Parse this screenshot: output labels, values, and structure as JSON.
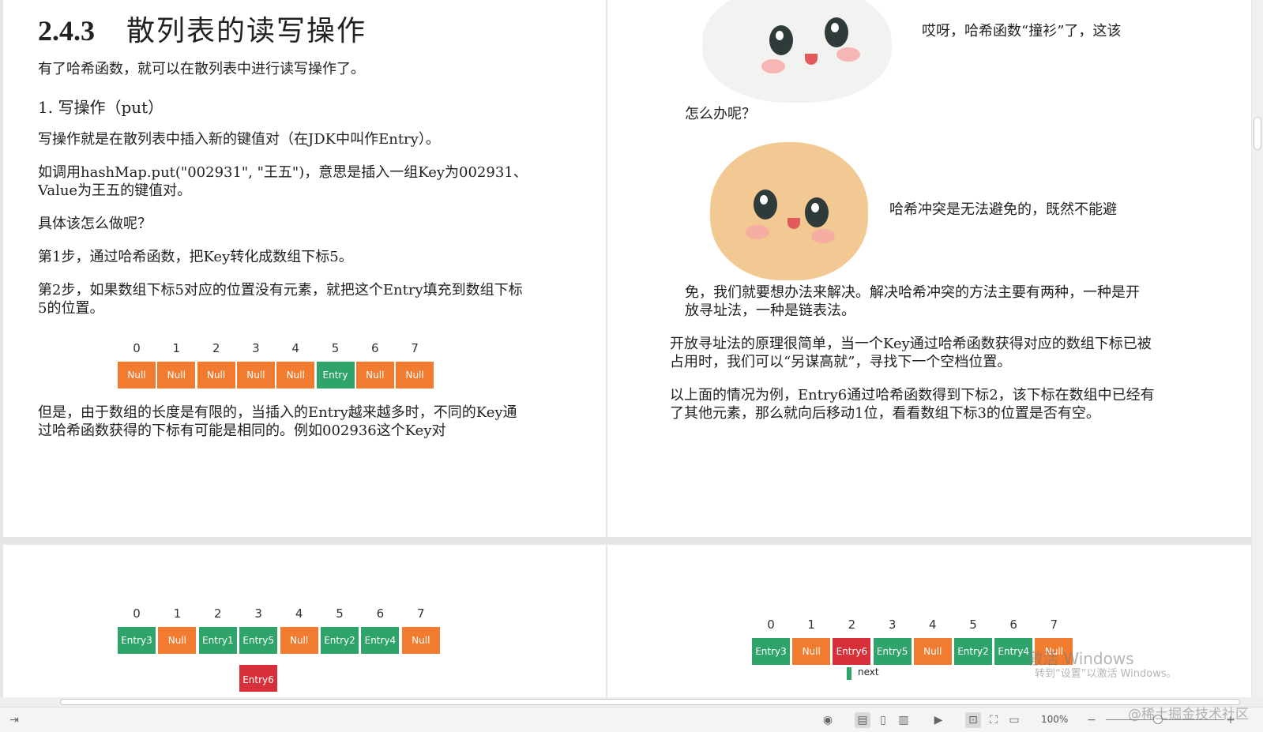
{
  "page1": {
    "section_num": "2.4.3",
    "section_title": "散列表的读写操作",
    "intro": "有了哈希函数，就可以在散列表中进行读写操作了。",
    "heading": "1. 写操作（put）",
    "p1": "写操作就是在散列表中插入新的键值对（在JDK中叫作Entry）。",
    "p2": "如调用hashMap.put(\"002931\", \"王五\")，意思是插入一组Key为002931、Value为王五的键值对。",
    "p3": "具体该怎么做呢？",
    "p4": "第1步，通过哈希函数，把Key转化成数组下标5。",
    "p5": "第2步，如果数组下标5对应的位置没有元素，就把这个Entry填充到数组下标5的位置。",
    "array": {
      "indices": [
        "0",
        "1",
        "2",
        "3",
        "4",
        "5",
        "6",
        "7"
      ],
      "cells": [
        {
          "label": "Null",
          "kind": "null"
        },
        {
          "label": "Null",
          "kind": "null"
        },
        {
          "label": "Null",
          "kind": "null"
        },
        {
          "label": "Null",
          "kind": "null"
        },
        {
          "label": "Null",
          "kind": "null"
        },
        {
          "label": "Entry",
          "kind": "entry"
        },
        {
          "label": "Null",
          "kind": "null"
        },
        {
          "label": "Null",
          "kind": "null"
        }
      ]
    },
    "p6": "但是，由于数组的长度是有限的，当插入的Entry越来越多时，不同的Key通过哈希函数获得的下标有可能是相同的。例如002936这个Key对"
  },
  "page2": {
    "bubble1": "哎呀，哈希函数“撞衫”了，这该",
    "bubble1_cont": "怎么办呢？",
    "bubble2": "哈希冲突是无法避免的，既然不能避",
    "bubble2_cont": "免，我们就要想办法来解决。解决哈希冲突的方法主要有两种，一种是开放寻址法，一种是链表法。",
    "p1": "开放寻址法的原理很简单，当一个Key通过哈希函数获得对应的数组下标已被占用时，我们可以“另谋高就”，寻找下一个空档位置。",
    "p2": "以上面的情况为例，Entry6通过哈希函数得到下标2，该下标在数组中已经有了其他元素，那么就向后移动1位，看看数组下标3的位置是否有空。"
  },
  "page3": {
    "array": {
      "indices": [
        "0",
        "1",
        "2",
        "3",
        "4",
        "5",
        "6",
        "7"
      ],
      "cells": [
        {
          "label": "Entry3",
          "kind": "entry"
        },
        {
          "label": "Null",
          "kind": "null"
        },
        {
          "label": "Entry1",
          "kind": "entry"
        },
        {
          "label": "Entry5",
          "kind": "entry"
        },
        {
          "label": "Null",
          "kind": "null"
        },
        {
          "label": "Entry2",
          "kind": "entry"
        },
        {
          "label": "Entry4",
          "kind": "entry"
        },
        {
          "label": "Null",
          "kind": "null"
        }
      ]
    },
    "incoming": "Entry6"
  },
  "page4": {
    "array": {
      "indices": [
        "0",
        "1",
        "2",
        "3",
        "4",
        "5",
        "6",
        "7"
      ],
      "cells": [
        {
          "label": "Entry3",
          "kind": "entry"
        },
        {
          "label": "Null",
          "kind": "null"
        },
        {
          "label": "Entry6",
          "kind": "conflict"
        },
        {
          "label": "Entry5",
          "kind": "entry"
        },
        {
          "label": "Null",
          "kind": "null"
        },
        {
          "label": "Entry2",
          "kind": "entry"
        },
        {
          "label": "Entry4",
          "kind": "entry"
        },
        {
          "label": "Null",
          "kind": "null"
        }
      ]
    },
    "next_label": "next"
  },
  "statusbar": {
    "zoom": "100%",
    "watermark": "@稀土掘金技术社区"
  },
  "activation": {
    "line1": "激活 Windows",
    "line2": "转到“设置”以激活 Windows。"
  },
  "colors": {
    "null": "#f17c2f",
    "entry": "#2fa46a",
    "conflict": "#d7303a"
  }
}
